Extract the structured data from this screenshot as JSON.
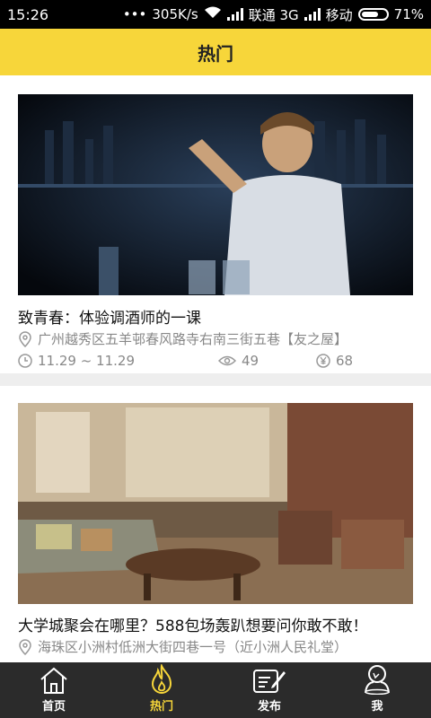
{
  "status_bar": {
    "time": "15:26",
    "dots": "•••",
    "speed": "305K/s",
    "carrier1": "联通 3G",
    "carrier2": "移动",
    "battery": "71%",
    "battery_level": 0.71
  },
  "header": {
    "title": "热门"
  },
  "events": [
    {
      "title": "致青春：体验调酒师的一课",
      "location": "广州越秀区五羊邨春风路寺右南三街五巷【友之屋】",
      "date": "11.29 ~ 11.29",
      "views": "49",
      "price": "68"
    },
    {
      "title": "大学城聚会在哪里？588包场轰趴想要问你敢不敢！",
      "location": "海珠区小洲村低洲大街四巷一号（近小洲人民礼堂）"
    }
  ],
  "tabbar": {
    "tabs": [
      {
        "label": "首页",
        "icon": "home-icon"
      },
      {
        "label": "热门",
        "icon": "flame-icon",
        "active": true
      },
      {
        "label": "发布",
        "icon": "compose-icon"
      },
      {
        "label": "我",
        "icon": "user-icon"
      }
    ]
  },
  "colors": {
    "accent": "#f7d63a",
    "tabbar": "#2b2b2b",
    "meta_text": "#888888"
  }
}
